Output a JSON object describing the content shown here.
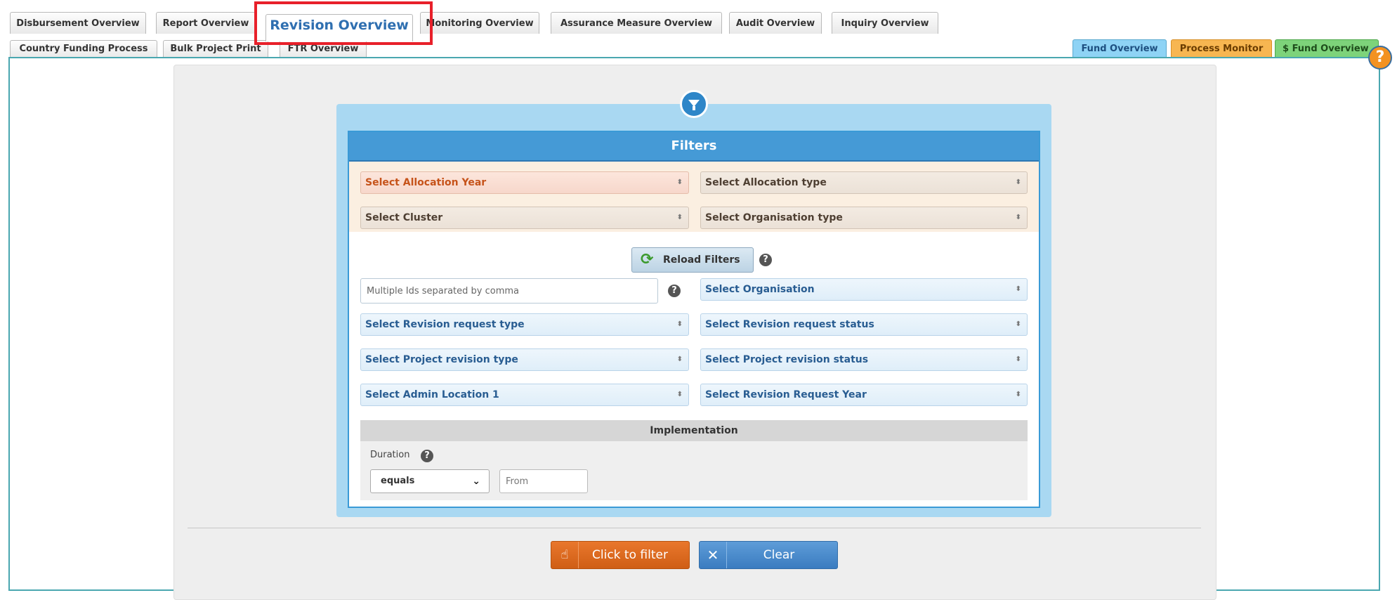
{
  "tabs_row1": [
    {
      "label": "Disbursement Overview"
    },
    {
      "label": "Report Overview"
    },
    {
      "label": "Revision Overview",
      "active": true
    },
    {
      "label": "Monitoring Overview"
    },
    {
      "label": "Assurance Measure Overview"
    },
    {
      "label": "Audit Overview"
    },
    {
      "label": "Inquiry Overview"
    }
  ],
  "tabs_row2": [
    {
      "label": "Country Funding Process"
    },
    {
      "label": "Bulk Project Print"
    },
    {
      "label": "FTR Overview"
    }
  ],
  "right_tabs": [
    {
      "label": "Fund Overview",
      "color": "#8ed3f5"
    },
    {
      "label": "Process Monitor",
      "color": "#f7b651"
    },
    {
      "label": "$ Fund Overview",
      "color": "#7dd37a"
    }
  ],
  "help_icon": "?",
  "filters": {
    "title": "Filters",
    "allocation_year": "Select Allocation Year",
    "allocation_type": "Select Allocation type",
    "cluster": "Select Cluster",
    "organisation_type": "Select Organisation type",
    "reload_label": "Reload Filters",
    "ids_placeholder": "Multiple Ids separated by comma",
    "organisation": "Select Organisation",
    "revision_request_type": "Select Revision request type",
    "revision_request_status": "Select Revision request status",
    "project_revision_type": "Select Project revision type",
    "project_revision_status": "Select Project revision status",
    "admin_location": "Select Admin Location 1",
    "revision_request_year": "Select Revision Request Year",
    "arrow": "⬍",
    "question_mark": "?"
  },
  "implementation": {
    "title": "Implementation",
    "duration_label": "Duration",
    "operator_value": "equals",
    "from_placeholder": "From"
  },
  "actions": {
    "filter_label": "Click to filter",
    "clear_label": "Clear",
    "close_glyph": "✕",
    "hand_glyph": "☝",
    "chevron_glyph": "⌄",
    "reload_glyph": "⟳"
  }
}
